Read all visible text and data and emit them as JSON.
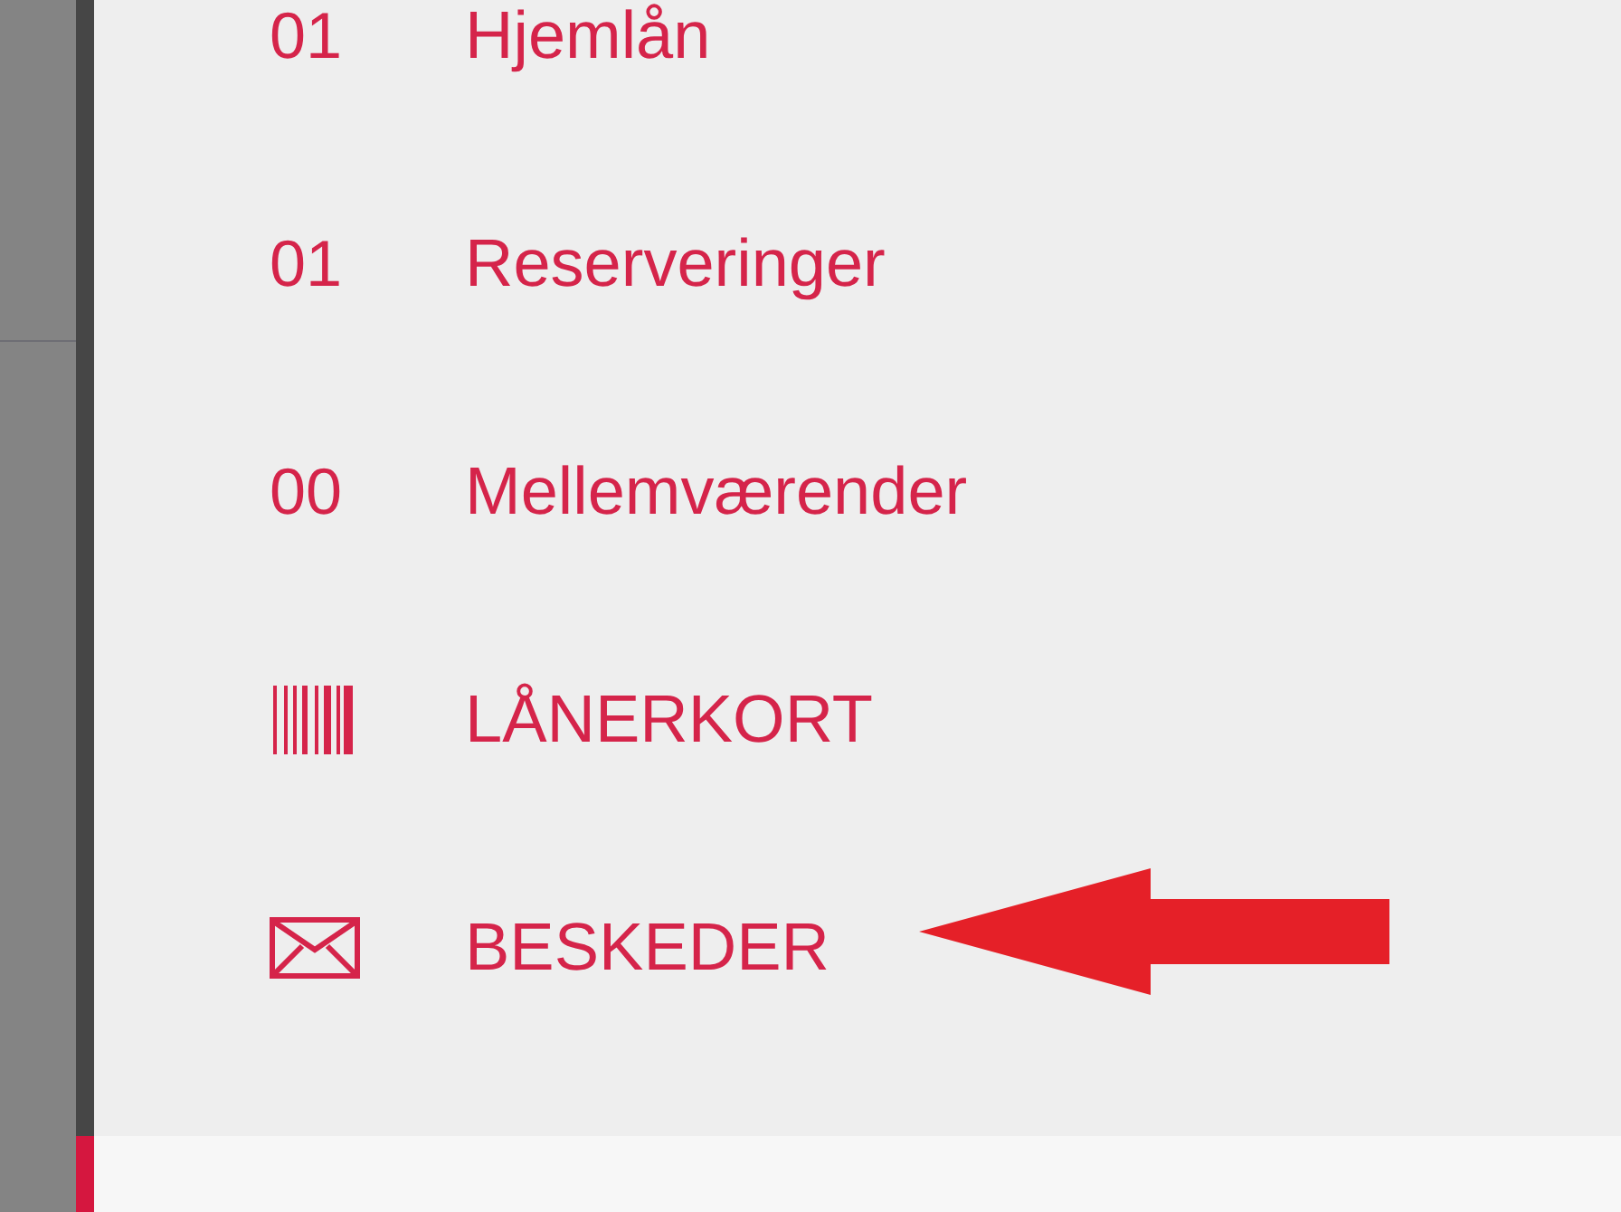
{
  "menu": {
    "items": [
      {
        "kind": "count",
        "count": "01",
        "label": "Hjemlån"
      },
      {
        "kind": "count",
        "count": "01",
        "label": "Reserveringer"
      },
      {
        "kind": "count",
        "count": "00",
        "label": "Mellemværender"
      },
      {
        "kind": "barcode",
        "label": "LÅNERKORT"
      },
      {
        "kind": "envelope",
        "label": "BESKEDER"
      }
    ]
  }
}
